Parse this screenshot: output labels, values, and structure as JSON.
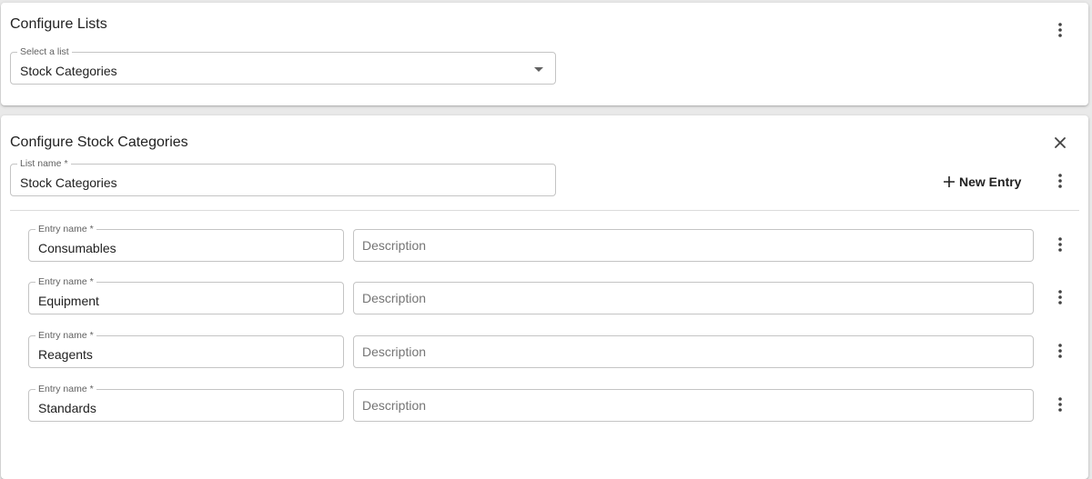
{
  "lists_panel": {
    "title": "Configure Lists",
    "select": {
      "label": "Select a list",
      "value": "Stock Categories"
    }
  },
  "config_panel": {
    "title": "Configure Stock Categories",
    "list_name": {
      "label": "List name *",
      "value": "Stock Categories"
    },
    "new_entry_label": "New Entry",
    "entries": [
      {
        "name_label": "Entry name *",
        "name": "Consumables",
        "description_placeholder": "Description"
      },
      {
        "name_label": "Entry name *",
        "name": "Equipment",
        "description_placeholder": "Description"
      },
      {
        "name_label": "Entry name *",
        "name": "Reagents",
        "description_placeholder": "Description"
      },
      {
        "name_label": "Entry name *",
        "name": "Standards",
        "description_placeholder": "Description"
      }
    ]
  },
  "icons": {
    "more": "more-vertical-icon",
    "close": "close-icon",
    "plus": "plus-icon",
    "dropdown": "chevron-down-icon"
  }
}
